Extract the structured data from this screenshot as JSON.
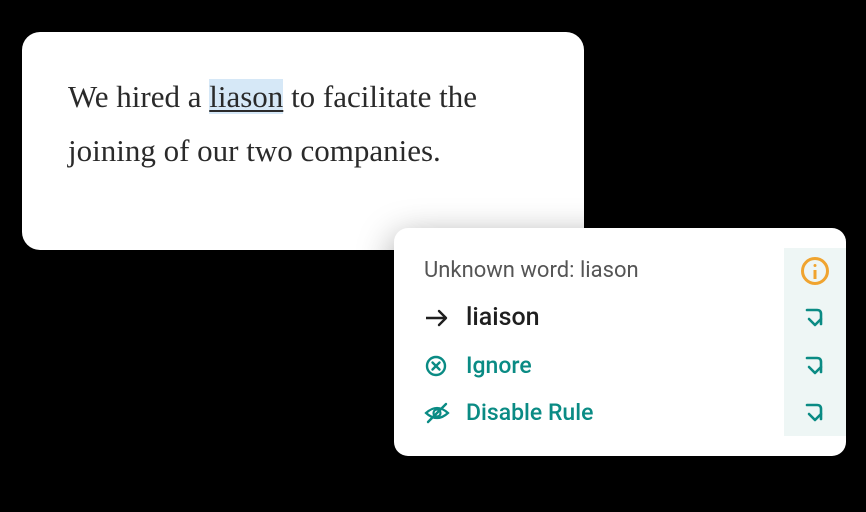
{
  "editor": {
    "prefix": "We hired a ",
    "flagged_word": "liason",
    "suffix": " to facilitate the joining of our two companies."
  },
  "suggestion": {
    "header_prefix": "Unknown word: ",
    "header_word": "liason",
    "correction": "liaison",
    "ignore_label": "Ignore",
    "disable_label": "Disable Rule"
  },
  "colors": {
    "accent": "#0a8b84",
    "warn": "#f0a42f"
  }
}
